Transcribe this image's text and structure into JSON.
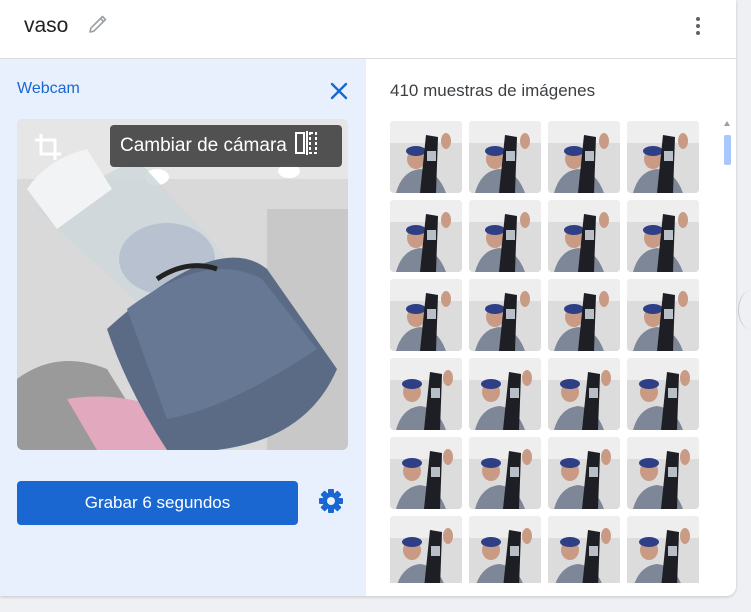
{
  "header": {
    "class_name": "vaso",
    "edit_icon": "pencil-icon",
    "menu_icon": "more-vert-icon"
  },
  "webcam": {
    "title": "Webcam",
    "close_icon": "close-icon",
    "crop_icon": "crop-icon",
    "switch_camera_label": "Cambiar de cámara",
    "switch_camera_icon": "flip-camera-icon",
    "record_label": "Grabar 6 segundos",
    "settings_icon": "gear-icon"
  },
  "samples": {
    "title": "410 muestras de imágenes",
    "visible_thumbnails": 24
  },
  "colors": {
    "accent": "#1a67d2",
    "left_panel_bg": "#e8f0fe",
    "link_blue": "#1967d2"
  }
}
